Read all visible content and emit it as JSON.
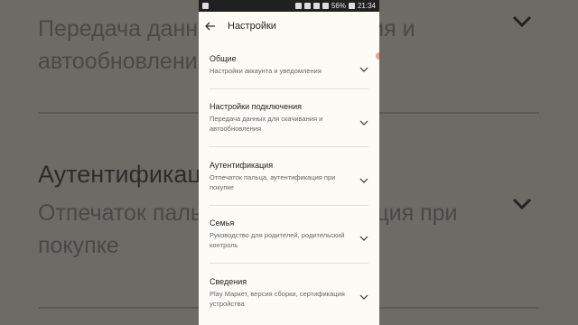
{
  "status": {
    "battery": "56%",
    "time": "21:34"
  },
  "header": {
    "title": "Настройки"
  },
  "settings": [
    {
      "title": "Общие",
      "subtitle": "Настройки аккаунта и уведомления"
    },
    {
      "title": "Настройки подключения",
      "subtitle": "Передача данных для скачивания и автообновления"
    },
    {
      "title": "Аутентификация",
      "subtitle": "Отпечаток пальца, аутентификация при покупке"
    },
    {
      "title": "Семья",
      "subtitle": "Руководство для родителей, родительский контроль"
    },
    {
      "title": "Сведения",
      "subtitle": "Play Маркет, версия сборки, сертификация устройства"
    }
  ],
  "background": {
    "line1": "Передача данных для скачивания и",
    "line2": "автообновления",
    "title": "Аутентификация",
    "line3": "Отпечаток пальца, аутентификация при",
    "line4": "покупке"
  },
  "colors": {
    "accent_dot": "#f3a08f",
    "surface": "#fdfbf6"
  }
}
